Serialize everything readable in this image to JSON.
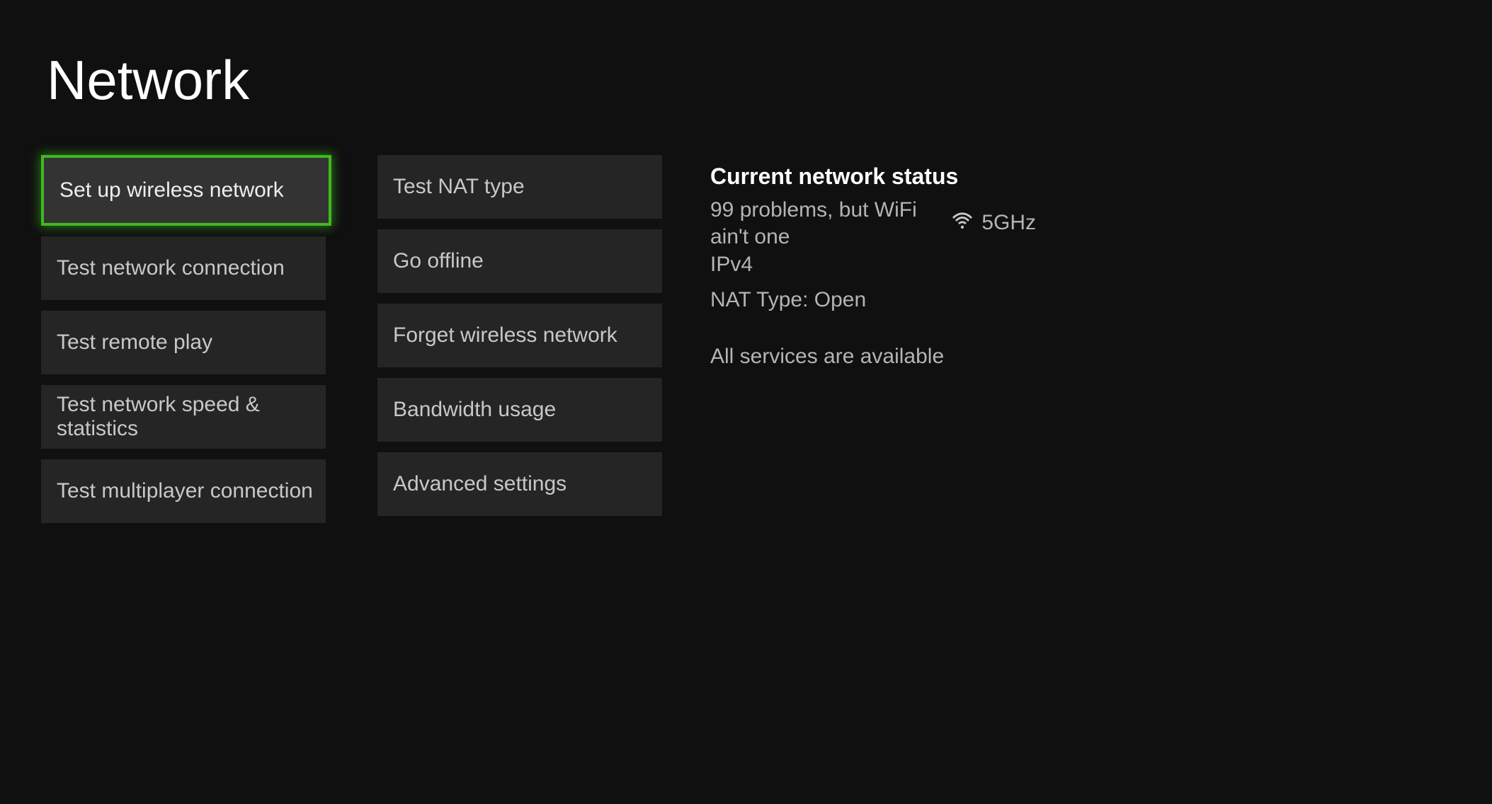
{
  "title": "Network",
  "buttons": {
    "col1": [
      {
        "label": "Set up wireless network",
        "selected": true
      },
      {
        "label": "Test network connection",
        "selected": false
      },
      {
        "label": "Test remote play",
        "selected": false
      },
      {
        "label": "Test network speed & statistics",
        "selected": false
      },
      {
        "label": "Test multiplayer connection",
        "selected": false
      }
    ],
    "col2": [
      {
        "label": "Test NAT type",
        "selected": false
      },
      {
        "label": "Go offline",
        "selected": false
      },
      {
        "label": "Forget wireless network",
        "selected": false
      },
      {
        "label": "Bandwidth usage",
        "selected": false
      },
      {
        "label": "Advanced settings",
        "selected": false
      }
    ]
  },
  "status": {
    "heading": "Current network status",
    "wifi_name": "99 problems, but WiFi ain't one",
    "band": "5GHz",
    "ip_version": "IPv4",
    "nat_type": "NAT Type: Open",
    "services": "All services are available"
  }
}
